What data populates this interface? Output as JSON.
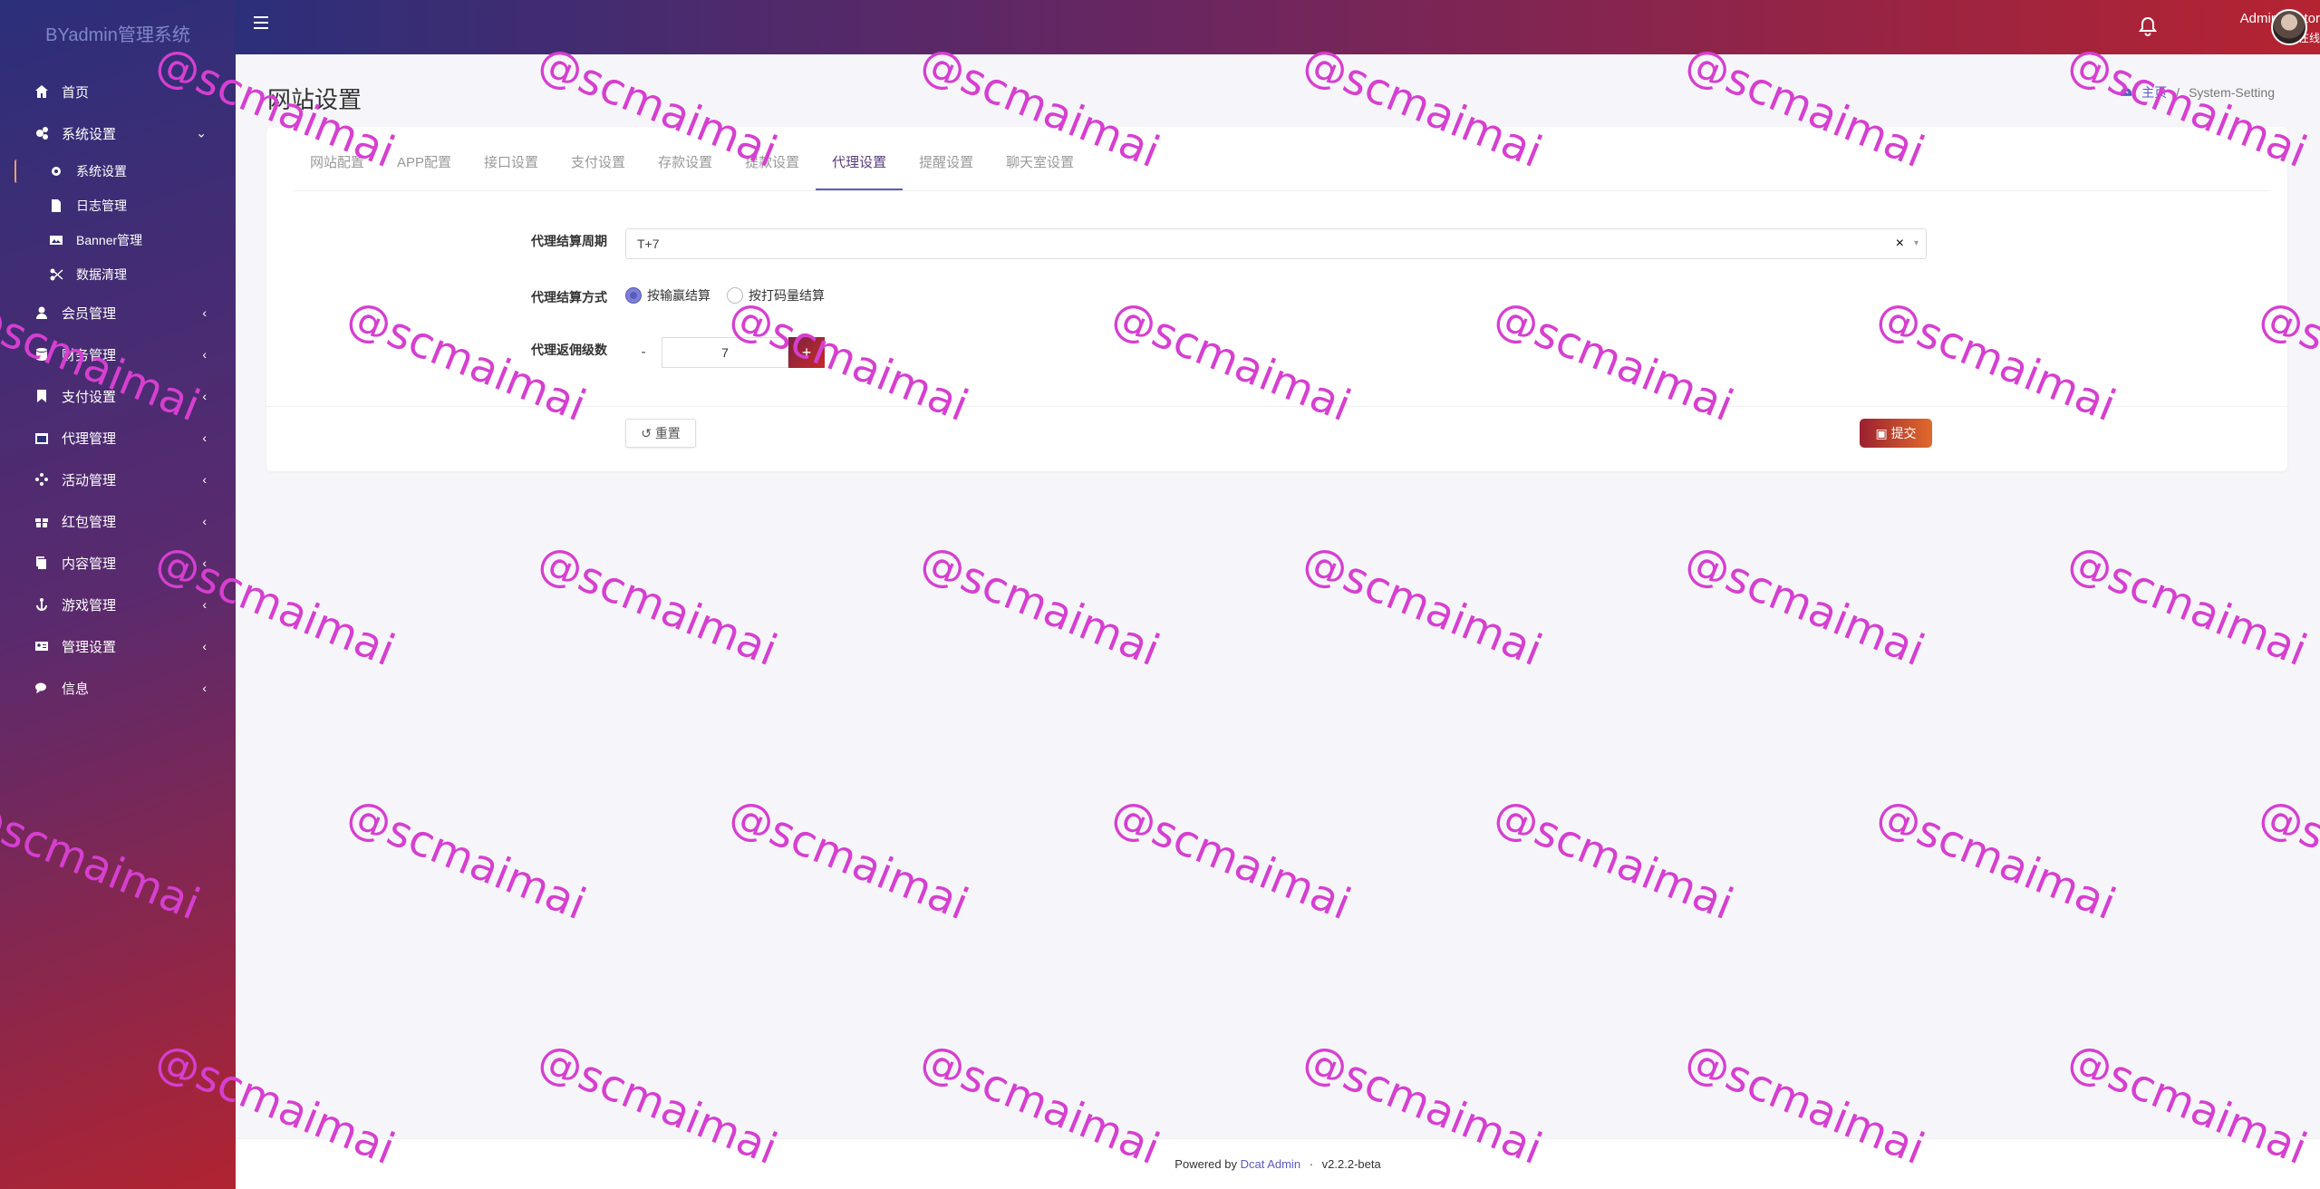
{
  "brand": "BYadmin管理系统",
  "topbar": {
    "user_name": "Administrator",
    "user_status": "在线"
  },
  "sidebar": {
    "items": [
      {
        "label": "首页",
        "icon": "home-icon",
        "arrow": ""
      },
      {
        "label": "系统设置",
        "icon": "cogs-icon",
        "arrow": "⌄"
      },
      {
        "label": "系统设置",
        "icon": "gear-icon",
        "arrow": "",
        "sub": true,
        "active": true
      },
      {
        "label": "日志管理",
        "icon": "file-icon",
        "arrow": "",
        "sub": true
      },
      {
        "label": "Banner管理",
        "icon": "image-icon",
        "arrow": "",
        "sub": true
      },
      {
        "label": "数据清理",
        "icon": "scissors-icon",
        "arrow": "",
        "sub": true
      },
      {
        "label": "会员管理",
        "icon": "user-icon",
        "arrow": "‹"
      },
      {
        "label": "财务管理",
        "icon": "database-icon",
        "arrow": "‹"
      },
      {
        "label": "支付设置",
        "icon": "bookmark-icon",
        "arrow": "‹"
      },
      {
        "label": "代理管理",
        "icon": "calendar-icon",
        "arrow": "‹"
      },
      {
        "label": "活动管理",
        "icon": "puzzle-icon",
        "arrow": "‹"
      },
      {
        "label": "红包管理",
        "icon": "gift-icon",
        "arrow": "‹"
      },
      {
        "label": "内容管理",
        "icon": "copy-icon",
        "arrow": "‹"
      },
      {
        "label": "游戏管理",
        "icon": "anchor-icon",
        "arrow": "‹"
      },
      {
        "label": "管理设置",
        "icon": "id-card-icon",
        "arrow": "‹"
      },
      {
        "label": "信息",
        "icon": "comments-icon",
        "arrow": "‹"
      }
    ]
  },
  "page": {
    "title": "网站设置",
    "breadcrumb_home": "主页",
    "breadcrumb_sep": "/",
    "breadcrumb_current": "System-Setting"
  },
  "tabs": [
    "网站配置",
    "APP配置",
    "接口设置",
    "支付设置",
    "存款设置",
    "提款设置",
    "代理设置",
    "提醒设置",
    "聊天室设置"
  ],
  "active_tab": 6,
  "form": {
    "cycle_label": "代理结算周期",
    "cycle_value": "T+7",
    "cycle_clear": "×",
    "method_label": "代理结算方式",
    "method_options": [
      "按输赢结算",
      "按打码量结算"
    ],
    "method_selected": 0,
    "level_label": "代理返佣级数",
    "level_value": "7",
    "minus": "-",
    "plus": "+",
    "reset_label": "重置",
    "submit_label": "提交"
  },
  "footer": {
    "powered": "Powered by",
    "link": "Dcat Admin",
    "sep": "·",
    "version": "v2.2.2-beta"
  },
  "watermark": "@scmaimai",
  "colors": {
    "accent": "#5a5bbf",
    "submit_start": "#9b2030",
    "submit_end": "#e06a2c",
    "watermark": "#d63fd0"
  }
}
